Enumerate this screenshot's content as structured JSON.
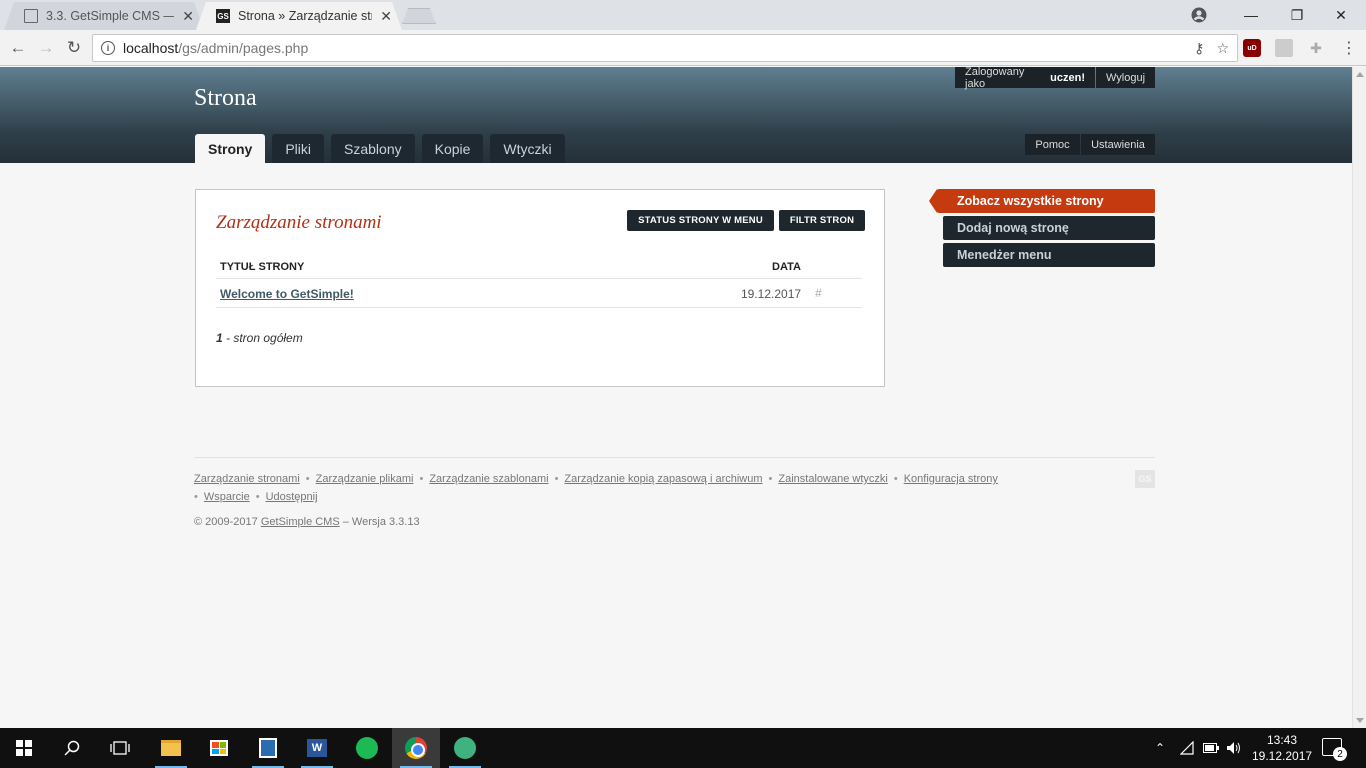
{
  "browser": {
    "tabs": [
      {
        "title": "3.3. GetSimple CMS — M",
        "active": false
      },
      {
        "title": "Strona » Zarządzanie str",
        "active": true
      }
    ],
    "url_host": "localhost",
    "url_path": "/gs/admin/pages.php",
    "close_glyph": "✕",
    "minimize_glyph": "—",
    "restore_glyph": "❐",
    "back_glyph": "←",
    "forward_glyph": "→",
    "reload_glyph": "↻",
    "key_glyph": "⚷",
    "star_glyph": "☆",
    "menu_glyph": "⋮",
    "ublock_label": "uD"
  },
  "header": {
    "site_title": "Strona",
    "logged_in_prefix": "Zalogowany jako",
    "username": "uczen!",
    "logout_label": "Wyloguj",
    "help_label": "Pomoc",
    "settings_label": "Ustawienia",
    "nav_tabs": [
      {
        "label": "Strony",
        "current": true
      },
      {
        "label": "Pliki",
        "current": false
      },
      {
        "label": "Szablony",
        "current": false
      },
      {
        "label": "Kopie",
        "current": false
      },
      {
        "label": "Wtyczki",
        "current": false
      }
    ]
  },
  "main": {
    "heading": "Zarządzanie stronami",
    "status_button": "STATUS STRONY W MENU",
    "filter_button": "FILTR STRON",
    "col_title": "TYTUŁ STRONY",
    "col_date": "DATA",
    "rows": [
      {
        "title": "Welcome to GetSimple!",
        "date": "19.12.2017",
        "hash": "#"
      }
    ],
    "total_count": "1",
    "total_label": " - stron ogółem"
  },
  "sidebar": {
    "items": [
      {
        "label": "Zobacz wszystkie strony",
        "current": true
      },
      {
        "label": "Dodaj nową stronę",
        "current": false
      },
      {
        "label": "Menedżer menu",
        "current": false
      }
    ]
  },
  "footer": {
    "links": [
      "Zarządzanie stronami",
      "Zarządzanie plikami",
      "Zarządzanie szablonami",
      "Zarządzanie kopią zapasową i archiwum",
      "Zainstalowane wtyczki",
      "Konfiguracja strony",
      "Wsparcie",
      "Udostępnij"
    ],
    "separator": "•",
    "copyright_prefix": "© 2009-2017",
    "product_link": "GetSimple CMS",
    "version_text": " – Wersja 3.3.13",
    "logo_text": "GS"
  },
  "taskbar": {
    "time": "13:43",
    "date": "19.12.2017",
    "notification_count": "2",
    "word_label": "W"
  },
  "colors": {
    "accent_orange": "#c63a10",
    "heading_red": "#b13016",
    "dark_nav": "#1e272d"
  }
}
